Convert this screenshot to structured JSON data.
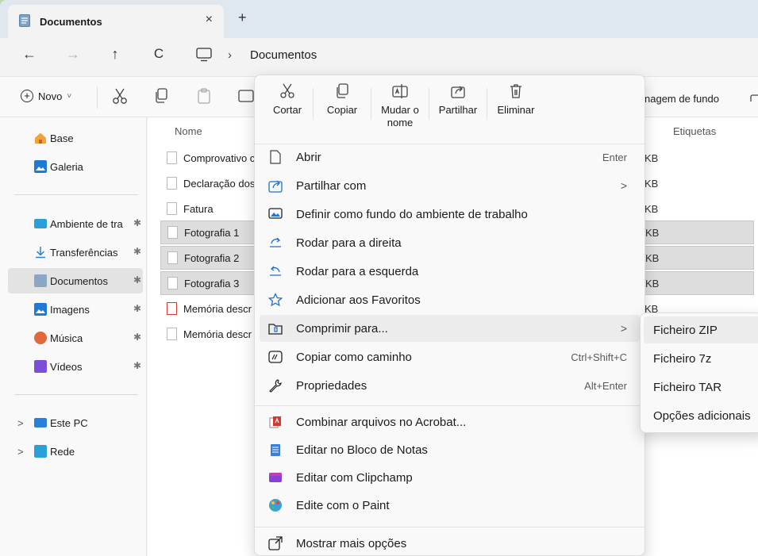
{
  "tab": {
    "title": "Documentos",
    "close": "×",
    "new_tab": "+"
  },
  "nav": {
    "back": "←",
    "forward": "→",
    "up": "↑",
    "refresh": "C",
    "separator": "›",
    "breadcrumb": "Documentos"
  },
  "toolbar": {
    "new_label": "Novo",
    "new_caret": "˅",
    "background_partial": "nagem de fundo"
  },
  "sidebar": {
    "items": [
      {
        "label": "Base",
        "icon": "home-icon",
        "color": "#f0a23b"
      },
      {
        "label": "Galeria",
        "icon": "gallery-icon",
        "color": "#1f7ad6"
      },
      {
        "label": "Ambiente de tra",
        "icon": "desktop-icon",
        "color": "#2b9fd8",
        "pin": "📌"
      },
      {
        "label": "Transferências",
        "icon": "download-icon",
        "color": "#2b7fd8",
        "pin": "📌"
      },
      {
        "label": "Documentos",
        "icon": "documents-icon",
        "color": "#8aa7c4",
        "pin": "📌"
      },
      {
        "label": "Imagens",
        "icon": "pictures-icon",
        "color": "#1f7ad6",
        "pin": "📌"
      },
      {
        "label": "Música",
        "icon": "music-icon",
        "color": "#e06a3a",
        "pin": "📌"
      },
      {
        "label": "Vídeos",
        "icon": "videos-icon",
        "color": "#7a4fd6",
        "pin": "📌"
      },
      {
        "label": "Este PC",
        "icon": "pc-icon",
        "color": "#2b7fd8",
        "expander": ">"
      },
      {
        "label": "Rede",
        "icon": "network-icon",
        "color": "#2b9fd8",
        "expander": ">"
      }
    ]
  },
  "content": {
    "columns": {
      "name": "Nome",
      "tags": "Etiquetas"
    },
    "files": [
      {
        "name": "Comprovativo c",
        "size": "KB",
        "selected": false,
        "type": "doc"
      },
      {
        "name": "Declaração dos",
        "size": "KB",
        "selected": false,
        "type": "doc"
      },
      {
        "name": "Fatura",
        "size": "KB",
        "selected": false,
        "type": "doc"
      },
      {
        "name": "Fotografia 1",
        "size": "KB",
        "selected": true,
        "type": "doc"
      },
      {
        "name": "Fotografia 2",
        "size": "KB",
        "selected": true,
        "type": "doc"
      },
      {
        "name": "Fotografia 3",
        "size": "KB",
        "selected": true,
        "type": "doc"
      },
      {
        "name": "Memória descr",
        "size": "KB",
        "selected": false,
        "type": "pdf"
      },
      {
        "name": "Memória descr",
        "size": "",
        "selected": false,
        "type": "doc"
      }
    ]
  },
  "context_menu": {
    "quick_actions": [
      {
        "label": "Cortar",
        "icon": "scissors-icon"
      },
      {
        "label": "Copiar",
        "icon": "copy-icon"
      },
      {
        "label": "Mudar o nome",
        "icon": "rename-icon"
      },
      {
        "label": "Partilhar",
        "icon": "share-icon"
      },
      {
        "label": "Eliminar",
        "icon": "trash-icon"
      }
    ],
    "items": [
      {
        "label": "Abrir",
        "shortcut": "Enter",
        "icon": "open-icon"
      },
      {
        "label": "Partilhar com",
        "arrow": ">",
        "icon": "share-icon"
      },
      {
        "label": "Definir como fundo do ambiente de trabalho",
        "icon": "wallpaper-icon"
      },
      {
        "label": "Rodar para a direita",
        "icon": "rotate-right-icon"
      },
      {
        "label": "Rodar para a esquerda",
        "icon": "rotate-left-icon"
      },
      {
        "label": "Adicionar aos Favoritos",
        "icon": "star-icon"
      },
      {
        "label": "Comprimir para...",
        "arrow": ">",
        "icon": "compress-icon"
      },
      {
        "label": "Copiar como caminho",
        "shortcut": "Ctrl+Shift+C",
        "icon": "path-icon"
      },
      {
        "label": "Propriedades",
        "shortcut": "Alt+Enter",
        "icon": "properties-icon"
      },
      {
        "label": "Combinar arquivos no Acrobat...",
        "icon": "acrobat-icon"
      },
      {
        "label": "Editar no Bloco de Notas",
        "icon": "notepad-icon"
      },
      {
        "label": "Editar com Clipchamp",
        "icon": "clipchamp-icon"
      },
      {
        "label": "Edite com o Paint",
        "icon": "paint-icon"
      },
      {
        "label": "Mostrar mais opções",
        "icon": "more-options-icon"
      }
    ]
  },
  "submenu": {
    "items": [
      {
        "label": "Ficheiro ZIP"
      },
      {
        "label": "Ficheiro 7z"
      },
      {
        "label": "Ficheiro TAR"
      },
      {
        "label": "Opções adicionais"
      }
    ]
  }
}
